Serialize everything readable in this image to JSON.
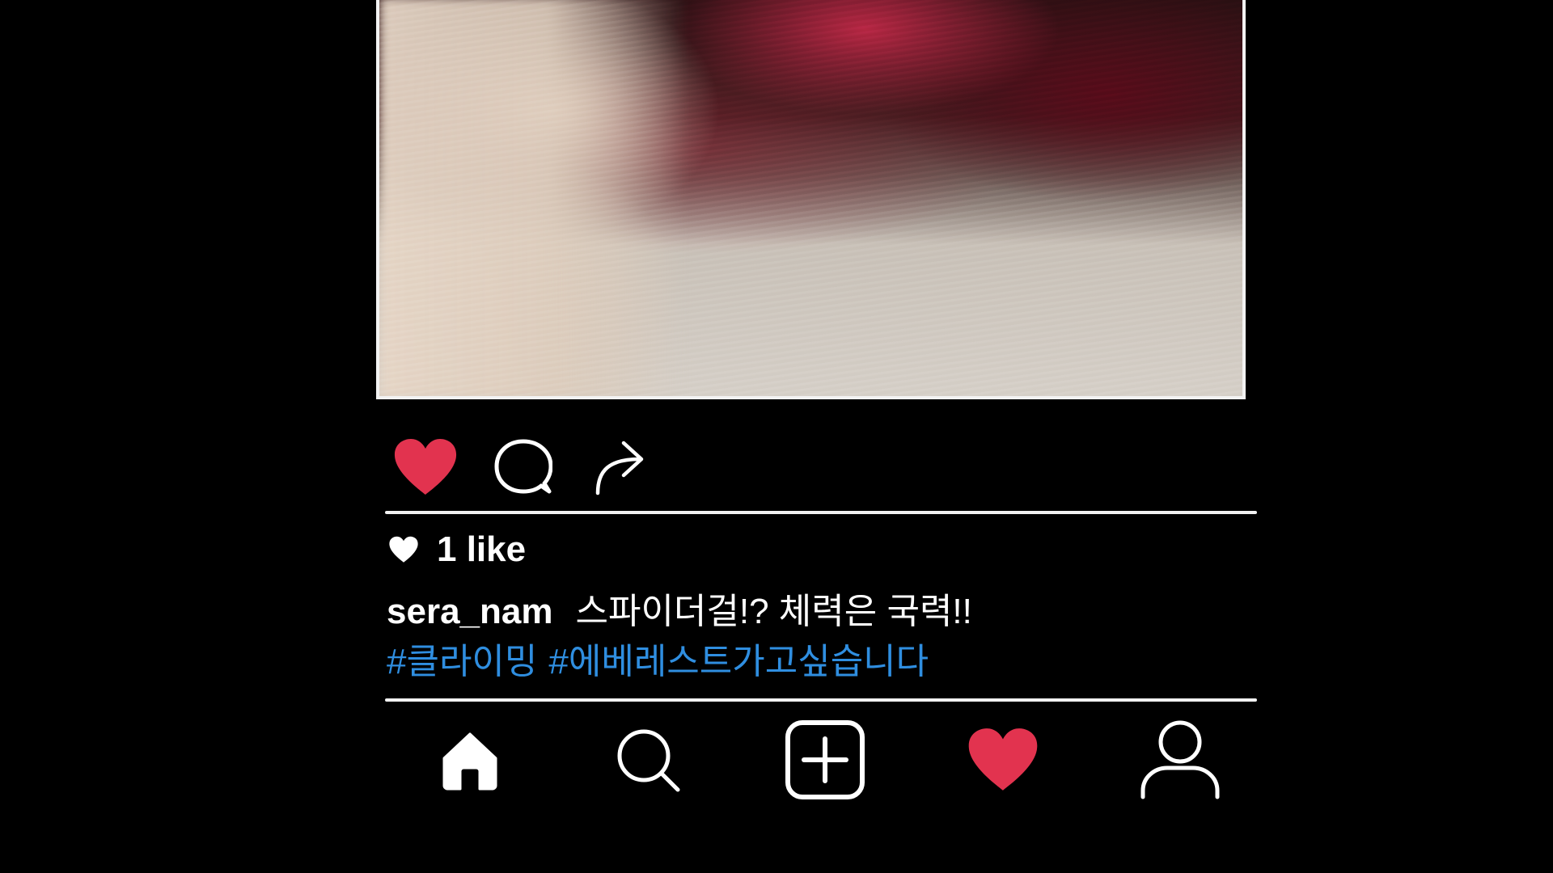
{
  "colors": {
    "background": "#000000",
    "text": "#ffffff",
    "like_red": "#e2334f",
    "hashtag_blue": "#2f8ee0",
    "divider": "#f2f2f2"
  },
  "post": {
    "photo_description": "",
    "actions": {
      "like_icon": "heart-filled-icon",
      "comment_icon": "speech-bubble-icon",
      "share_icon": "share-arrow-icon"
    },
    "likes": {
      "icon": "heart-icon",
      "text": "1 like"
    },
    "caption": {
      "username": "sera_nam",
      "text": "스파이더걸!? 체력은 국력!!",
      "hashtags": [
        "#클라이밍",
        "#에베레스트가고싶습니다"
      ]
    }
  },
  "bottom_nav": {
    "items": [
      {
        "name": "home",
        "icon": "home-icon"
      },
      {
        "name": "search",
        "icon": "search-icon"
      },
      {
        "name": "add-post",
        "icon": "plus-square-icon"
      },
      {
        "name": "activity",
        "icon": "heart-filled-icon"
      },
      {
        "name": "profile",
        "icon": "user-icon"
      }
    ]
  }
}
